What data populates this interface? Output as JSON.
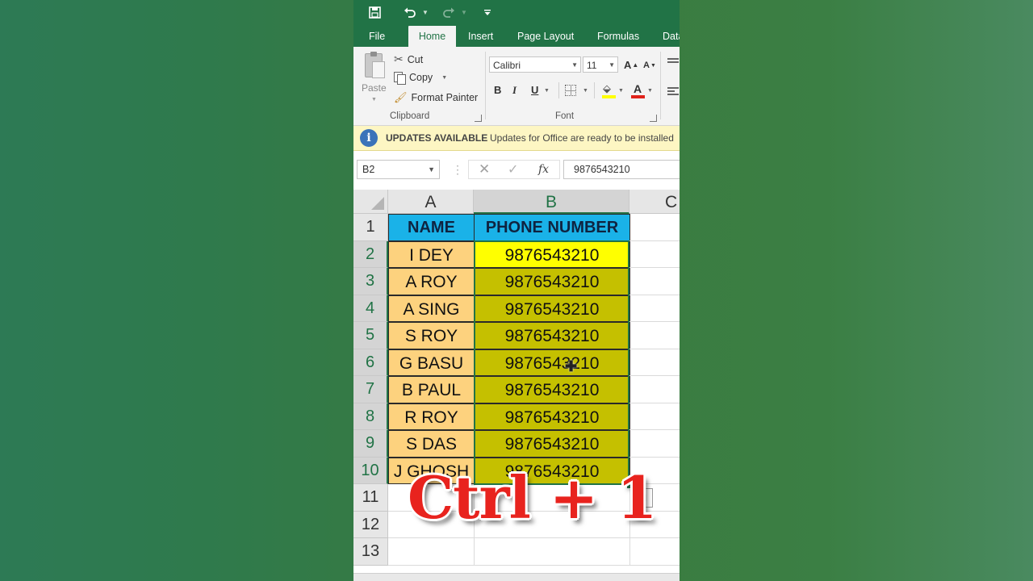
{
  "qat": {
    "save_icon": "save-icon",
    "undo_icon": "undo-icon",
    "redo_icon": "redo-icon",
    "customize_icon": "customize-qat-icon"
  },
  "tabs": [
    {
      "label": "File",
      "active": false
    },
    {
      "label": "Home",
      "active": true
    },
    {
      "label": "Insert",
      "active": false
    },
    {
      "label": "Page Layout",
      "active": false
    },
    {
      "label": "Formulas",
      "active": false
    },
    {
      "label": "Data",
      "active": false
    }
  ],
  "clipboard": {
    "paste_label": "Paste",
    "cut_label": "Cut",
    "copy_label": "Copy",
    "format_painter_label": "Format Painter",
    "group_label": "Clipboard"
  },
  "font": {
    "font_name": "Calibri",
    "font_size": "11",
    "grow_label": "A",
    "shrink_label": "A",
    "bold_label": "B",
    "italic_label": "I",
    "underline_label": "U",
    "font_color_label": "A",
    "group_label": "Font"
  },
  "message_bar": {
    "title": "UPDATES AVAILABLE",
    "text": "Updates for Office are ready to be installed"
  },
  "formula_bar": {
    "name_box": "B2",
    "cancel_glyph": "✕",
    "enter_glyph": "✓",
    "fx_glyph": "fx",
    "content": "9876543210"
  },
  "sheet": {
    "columns": [
      "A",
      "B",
      "C"
    ],
    "rows": [
      "1",
      "2",
      "3",
      "4",
      "5",
      "6",
      "7",
      "8",
      "9",
      "10",
      "11",
      "12",
      "13"
    ],
    "header": {
      "name": "NAME",
      "phone": "PHONE NUMBER"
    },
    "records": [
      {
        "name": "I DEY",
        "phone": "9876543210"
      },
      {
        "name": "A ROY",
        "phone": "9876543210"
      },
      {
        "name": "A SING",
        "phone": "9876543210"
      },
      {
        "name": "S ROY",
        "phone": "9876543210"
      },
      {
        "name": "G BASU",
        "phone": "9876543210"
      },
      {
        "name": "B PAUL",
        "phone": "9876543210"
      },
      {
        "name": "R ROY",
        "phone": "9876543210"
      },
      {
        "name": "S DAS",
        "phone": "9876543210"
      },
      {
        "name": "J GHOSH",
        "phone": "9876543210"
      }
    ],
    "active_cell": "B2"
  },
  "overlay": {
    "shortcut_text": "Ctrl + 1"
  },
  "colors": {
    "excel_green": "#217346",
    "header_fill": "#1ab2e8",
    "name_fill": "#fdd27e",
    "phone_fill": "#c5c000",
    "active_fill": "#ffff00",
    "shortcut_red": "#e8231e"
  }
}
